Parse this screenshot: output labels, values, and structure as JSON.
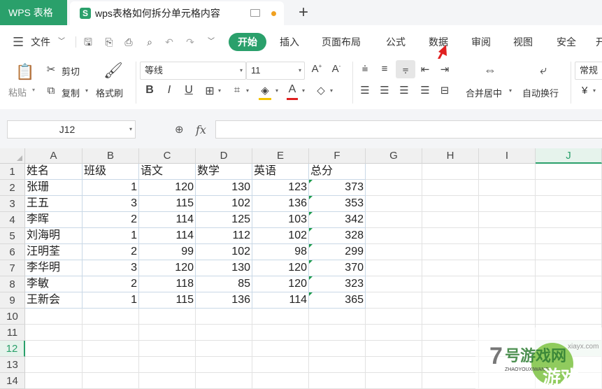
{
  "titlebar": {
    "app_tab": "WPS 表格",
    "doc_tab_icon": "S",
    "doc_title": "wps表格如何拆分单元格内容",
    "new_tab": "+"
  },
  "menubar": {
    "file_label": "文件",
    "tabs": [
      "开始",
      "插入",
      "页面布局",
      "公式",
      "数据",
      "审阅",
      "视图",
      "安全",
      "开"
    ]
  },
  "ribbon": {
    "paste": "粘贴",
    "cut": "剪切",
    "copy": "复制",
    "format_painter": "格式刷",
    "font_name": "等线",
    "font_size": "11",
    "merge_center": "合并居中",
    "wrap_text": "自动换行",
    "number_format": "常规",
    "currency": "¥"
  },
  "formula_bar": {
    "name_box": "J12",
    "fx": "fx",
    "value": ""
  },
  "sheet": {
    "columns": [
      "A",
      "B",
      "C",
      "D",
      "E",
      "F",
      "G",
      "H",
      "I",
      "J"
    ],
    "selected_column": "J",
    "selected_row": 12,
    "rows": [
      "1",
      "2",
      "3",
      "4",
      "5",
      "6",
      "7",
      "8",
      "9",
      "10",
      "11",
      "12",
      "13",
      "14"
    ],
    "header": [
      "姓名",
      "班级",
      "语文",
      "数学",
      "英语",
      "总分"
    ],
    "data": [
      [
        "张珊",
        "1",
        "120",
        "130",
        "123",
        "373"
      ],
      [
        "王五",
        "3",
        "115",
        "102",
        "136",
        "353"
      ],
      [
        "李晖",
        "2",
        "114",
        "125",
        "103",
        "342"
      ],
      [
        "刘海明",
        "1",
        "114",
        "112",
        "102",
        "328"
      ],
      [
        "汪明荃",
        "2",
        "99",
        "102",
        "98",
        "299"
      ],
      [
        "李华明",
        "3",
        "120",
        "130",
        "120",
        "370"
      ],
      [
        "李敏",
        "2",
        "118",
        "85",
        "120",
        "323"
      ],
      [
        "王新会",
        "1",
        "115",
        "136",
        "114",
        "365"
      ]
    ]
  },
  "colors": {
    "accent": "#2aa06b",
    "annotation_arrow": "#e02020"
  },
  "watermark": {
    "brand": "7号游戏网",
    "sub": "ZHAOYOUXIWANG",
    "site": "xiayx.com"
  }
}
